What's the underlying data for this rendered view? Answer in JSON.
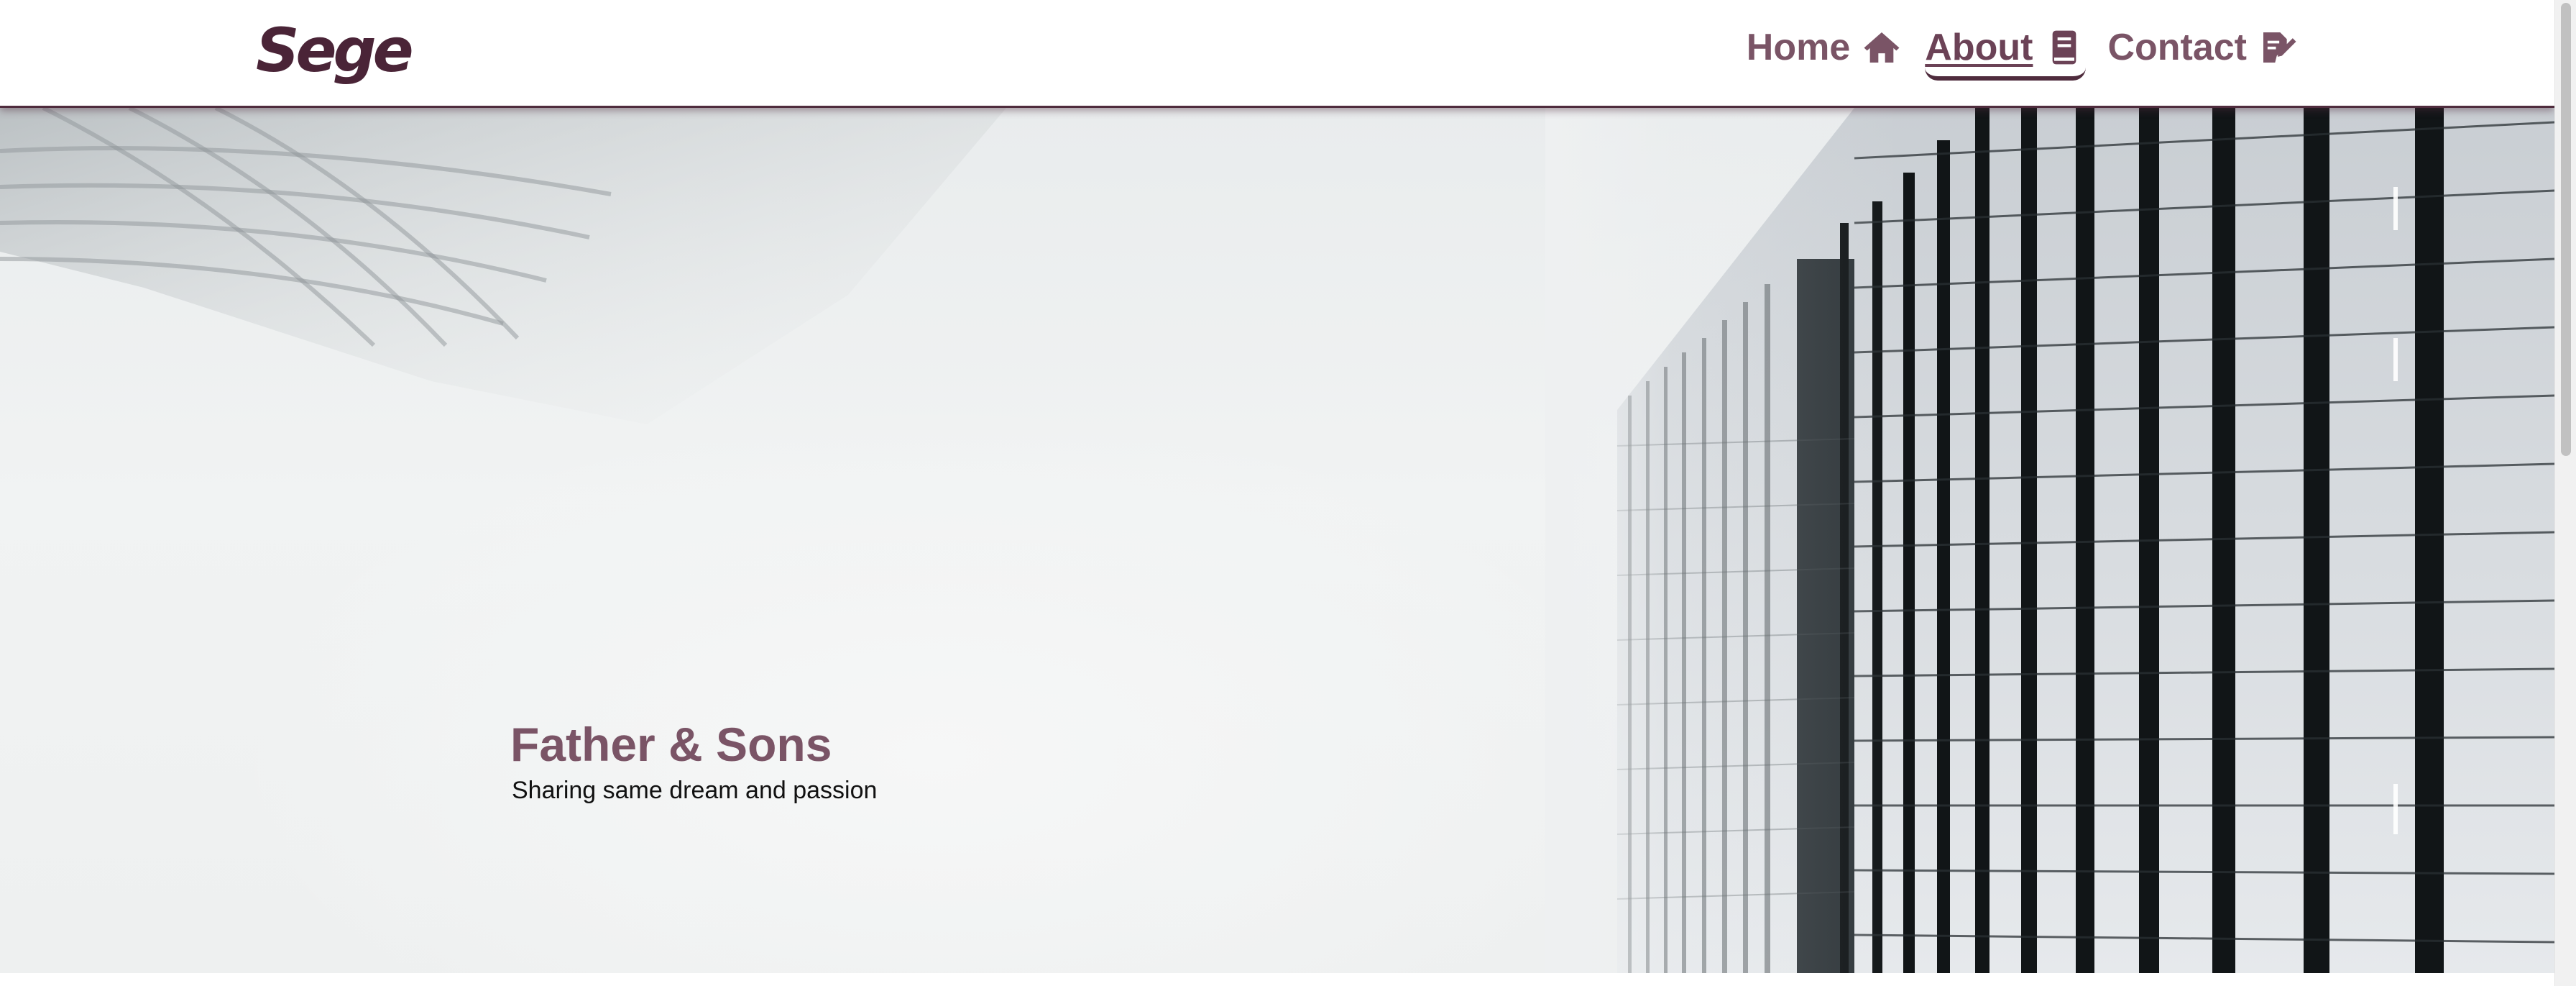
{
  "brand": {
    "logo_text": "Sege",
    "color": "#4a2437"
  },
  "nav": {
    "items": [
      {
        "label": "Home",
        "icon": "home-icon",
        "active": false
      },
      {
        "label": "About",
        "icon": "book-icon",
        "active": true
      },
      {
        "label": "Contact",
        "icon": "edit-icon",
        "active": false
      }
    ],
    "color": "#7a5466"
  },
  "hero": {
    "title": "Father & Sons",
    "subtitle": "Sharing same dream and passion"
  }
}
